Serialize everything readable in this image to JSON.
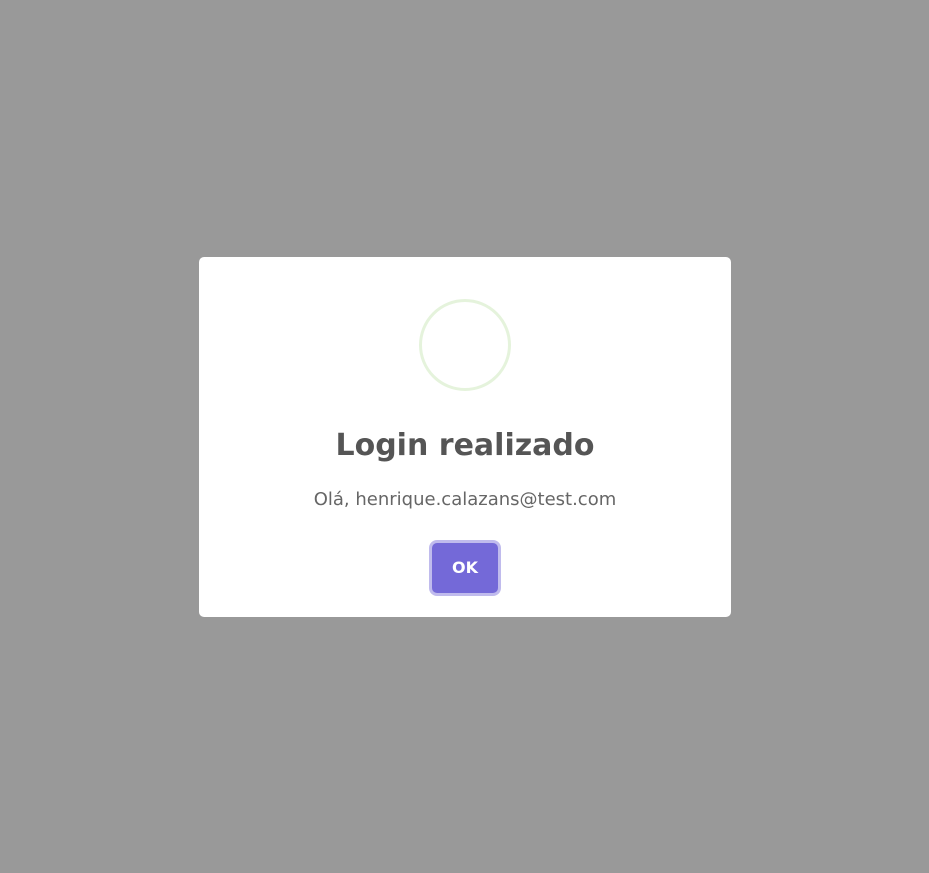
{
  "dialog": {
    "title": "Login realizado",
    "message": "Olá, henrique.calazans@test.com",
    "icon": "success-circle-icon",
    "ok_label": "OK"
  },
  "colors": {
    "overlay": "#999999",
    "dialog_background": "#ffffff",
    "icon_ring": "#e5f3dc",
    "title_text": "#555555",
    "message_text": "#666666",
    "button_background": "#7469d8",
    "button_text": "#ffffff"
  }
}
